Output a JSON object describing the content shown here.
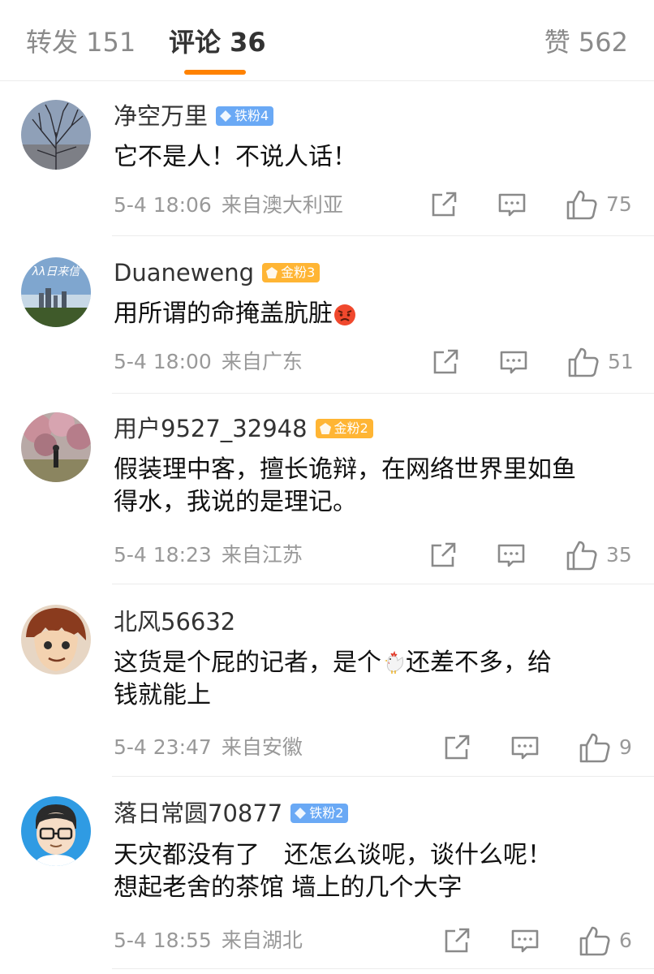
{
  "tabs": {
    "repost": "转发 151",
    "comments": "评论 36",
    "likes": "赞 562"
  },
  "colors": {
    "accent": "#ff8200",
    "iron_badge": "#6aa9f5",
    "gold_badge": "#ffb534"
  },
  "comments": [
    {
      "username": "净空万里",
      "badge": "铁粉4",
      "badge_icon": "diamond-icon",
      "text": "它不是人！不说人话！",
      "time": "5-4 18:06",
      "source": "来自澳大利亚",
      "likes": "75"
    },
    {
      "username": "Duaneweng",
      "badge": "金粉3",
      "badge_icon": "pentagon-icon",
      "text": "用所谓的命掩盖肮脏",
      "emoji": "angry-face-emoji",
      "time": "5-4 18:00",
      "source": "来自广东",
      "likes": "51"
    },
    {
      "username": "用户9527_32948",
      "badge": "金粉2",
      "badge_icon": "pentagon-icon",
      "text_line1": "假装理中客，擅长诡辩，在网络世界里如鱼",
      "text_line2": "得水，我说的是理记。",
      "time": "5-4 18:23",
      "source": "来自江苏",
      "likes": "35"
    },
    {
      "username": "北风56632",
      "text_a": "这货是个屁的记者，是个",
      "emoji": "rooster-emoji",
      "text_b": "还差不多，给",
      "text_line2": "钱就能上",
      "time": "5-4 23:47",
      "source": "来自安徽",
      "likes": "9"
    },
    {
      "username": "落日常圆70877",
      "badge": "铁粉2",
      "badge_icon": "diamond-icon",
      "text_line1": "天灾都没有了　还怎么谈呢，谈什么呢！",
      "text_line2": "想起老舍的茶馆 墙上的几个大字",
      "time": "5-4 18:55",
      "source": "来自湖北",
      "likes": "6"
    }
  ]
}
